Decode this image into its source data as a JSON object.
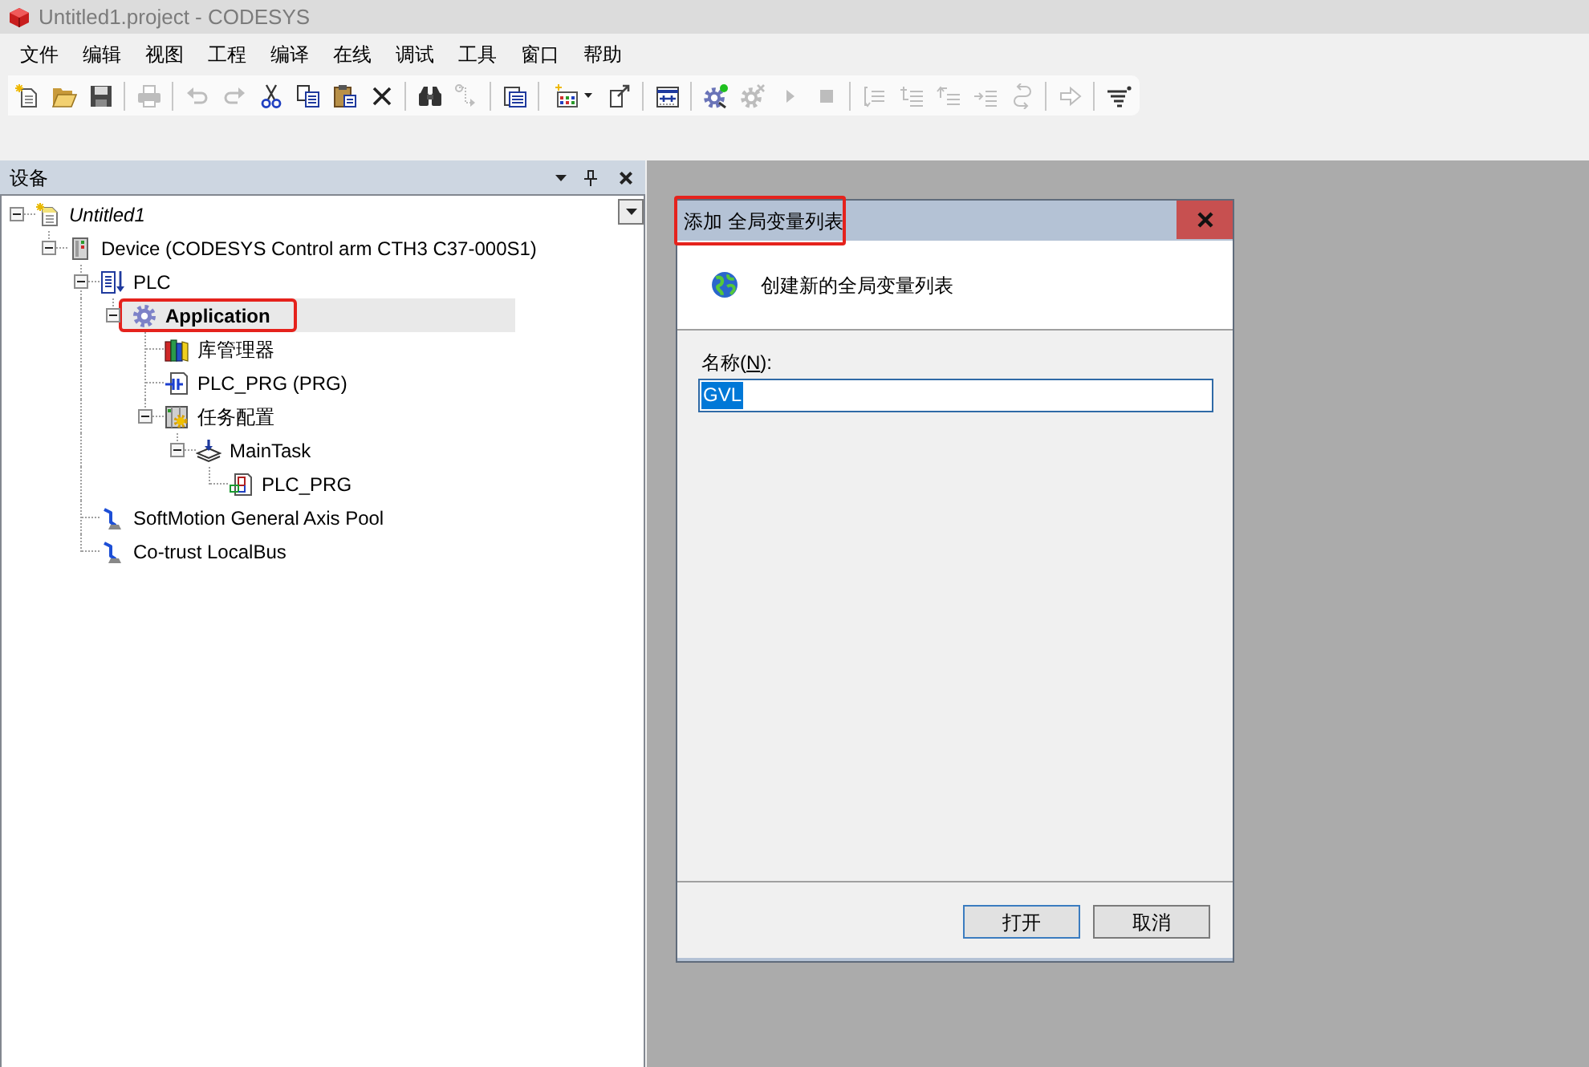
{
  "window": {
    "title": "Untitled1.project - CODESYS"
  },
  "menu": [
    "文件",
    "编辑",
    "视图",
    "工程",
    "编译",
    "在线",
    "调试",
    "工具",
    "窗口",
    "帮助"
  ],
  "toolbar": {
    "groups": [
      [
        {
          "disabled": false
        },
        {
          "disabled": false
        },
        {
          "disabled": false
        }
      ],
      [
        {
          "disabled": true
        }
      ],
      [
        {
          "disabled": true
        },
        {
          "disabled": true
        },
        {
          "disabled": false
        },
        {
          "disabled": false
        },
        {
          "disabled": false
        },
        {
          "disabled": false
        }
      ],
      [
        {
          "disabled": false
        },
        {
          "disabled": true
        }
      ],
      [
        {
          "disabled": false
        }
      ],
      [
        {
          "disabled": false
        },
        {
          "disabled": false
        }
      ],
      [
        {
          "disabled": false
        }
      ],
      [
        {
          "disabled": false
        },
        {
          "disabled": true
        },
        {
          "disabled": true
        },
        {
          "disabled": true
        }
      ],
      [
        {
          "disabled": true
        },
        {
          "disabled": true
        },
        {
          "disabled": true
        },
        {
          "disabled": true
        },
        {
          "disabled": true
        }
      ],
      [
        {
          "disabled": true
        }
      ],
      [
        {
          "disabled": false
        }
      ]
    ]
  },
  "devices_panel": {
    "title": "设备",
    "tree": [
      {
        "label": "Untitled1",
        "kind": "project",
        "selected": false,
        "expanded": true,
        "children": [
          {
            "label": "Device (CODESYS Control arm CTH3 C37-000S1)",
            "kind": "device",
            "selected": false,
            "expanded": true,
            "children": [
              {
                "label": "PLC",
                "kind": "plc",
                "selected": false,
                "expanded": true,
                "children": [
                  {
                    "label": "Application",
                    "kind": "application",
                    "selected": true,
                    "annotated": true,
                    "expanded": true,
                    "children": [
                      {
                        "label": "库管理器",
                        "kind": "library",
                        "selected": false
                      },
                      {
                        "label": "PLC_PRG (PRG)",
                        "kind": "pou",
                        "selected": false
                      },
                      {
                        "label": "任务配置",
                        "kind": "task_config",
                        "selected": false,
                        "expanded": true,
                        "children": [
                          {
                            "label": "MainTask",
                            "kind": "task",
                            "selected": false,
                            "expanded": true,
                            "children": [
                              {
                                "label": "PLC_PRG",
                                "kind": "task_call",
                                "selected": false
                              }
                            ]
                          }
                        ]
                      }
                    ]
                  }
                ]
              },
              {
                "label": "SoftMotion General Axis Pool",
                "kind": "axis_pool",
                "selected": false
              },
              {
                "label": "Co-trust LocalBus",
                "kind": "bus",
                "selected": false
              }
            ]
          }
        ]
      }
    ]
  },
  "dialog": {
    "title": "添加 全局变量列表",
    "title_annotated": true,
    "heading": "创建新的全局变量列表",
    "name_field": {
      "label_before": "名称(",
      "access_key": "N",
      "label_after": "):",
      "value": "GVL",
      "value_selected": true
    },
    "buttons": [
      {
        "label": "打开",
        "default": true
      },
      {
        "label": "取消",
        "default": false
      }
    ]
  }
}
